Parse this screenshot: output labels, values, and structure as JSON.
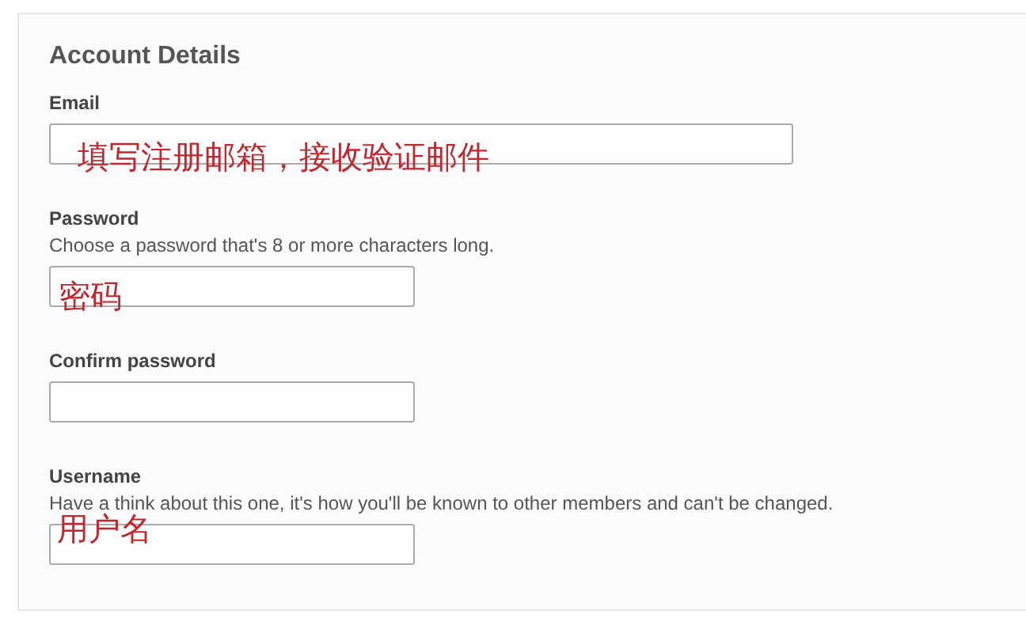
{
  "section": {
    "title": "Account Details"
  },
  "fields": [
    {
      "label": "Email",
      "kind": "wide",
      "annotation": "填写注册邮箱，接收验证邮件"
    },
    {
      "label": "Password",
      "kind": "narrow",
      "hint": "Choose a password that's 8 or more characters long.",
      "annotation": "密码"
    },
    {
      "label": "Confirm password",
      "kind": "narrow"
    },
    {
      "label": "Username",
      "kind": "narrow",
      "hint": "Have a think about this one, it's how you'll be known to other members and can't be changed.",
      "annotation": "用户名"
    }
  ]
}
